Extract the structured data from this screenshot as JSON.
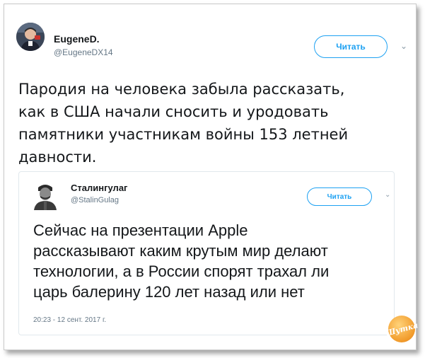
{
  "tweet": {
    "author_name": "EugeneD.",
    "author_handle": "@EugeneDX14",
    "follow_label": "Читать",
    "text": "Пародия на человека забыла рассказать,\nкак в США начали сносить и уродовать\nпамятники участникам войны 153 летней\nдавности.",
    "menu_icon": "chevron-down-icon",
    "avatar_icon": "avatar"
  },
  "quoted": {
    "author_name": "Сталингулаг",
    "author_handle": "@StalinGulag",
    "follow_label": "Читать",
    "text": "Сейчас на презентации Apple\nрассказывают каким крутым мир делают\nтехнологии, а в России спорят трахал ли\nцарь балерину 120 лет назад или нет",
    "timestamp": "20:23 - 12 сент. 2017 г.",
    "menu_icon": "chevron-down-icon"
  },
  "watermark": {
    "text": "Шутка"
  },
  "colors": {
    "accent": "#1da1f2",
    "text": "#14171a",
    "muted": "#657786",
    "border": "#e1e8ed",
    "logo": "#f19a2a"
  }
}
